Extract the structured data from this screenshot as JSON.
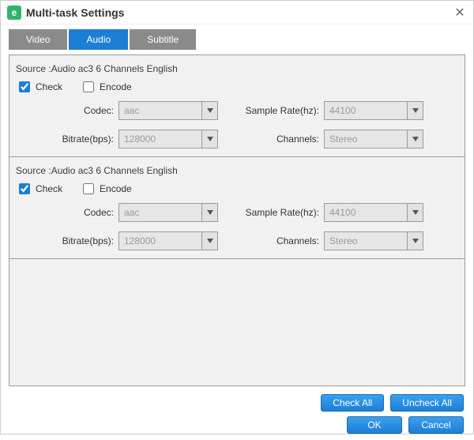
{
  "window": {
    "title": "Multi-task Settings",
    "app_icon_letter": "e"
  },
  "tabs": {
    "video": "Video",
    "audio": "Audio",
    "subtitle": "Subtitle",
    "active": "audio"
  },
  "labels": {
    "check": "Check",
    "encode": "Encode",
    "codec": "Codec:",
    "sample_rate": "Sample Rate(hz):",
    "bitrate": "Bitrate(bps):",
    "channels": "Channels:"
  },
  "tracks": [
    {
      "source": "Source :Audio  ac3  6 Channels  English",
      "check": true,
      "encode": false,
      "codec": "aac",
      "sample_rate": "44100",
      "bitrate": "128000",
      "channels": "Stereo"
    },
    {
      "source": "Source :Audio  ac3  6 Channels  English",
      "check": true,
      "encode": false,
      "codec": "aac",
      "sample_rate": "44100",
      "bitrate": "128000",
      "channels": "Stereo"
    }
  ],
  "buttons": {
    "check_all": "Check All",
    "uncheck_all": "Uncheck All",
    "ok": "OK",
    "cancel": "Cancel"
  }
}
